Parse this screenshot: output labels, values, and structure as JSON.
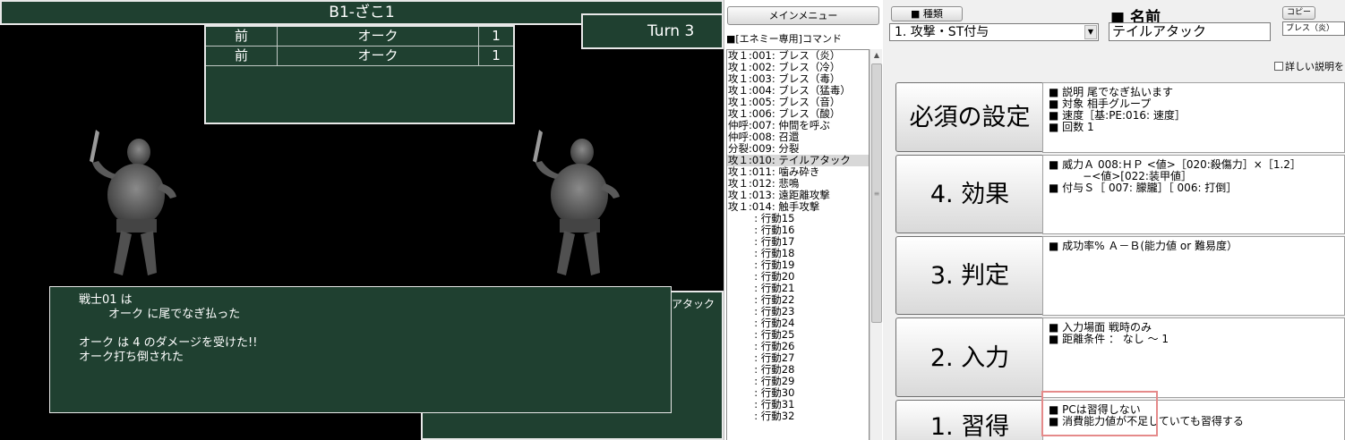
{
  "game": {
    "title": "B1-ざこ1",
    "turn": "Turn 3",
    "enemies": [
      {
        "row": "前",
        "name": "オーク",
        "count": "1"
      },
      {
        "row": "前",
        "name": "オーク",
        "count": "1"
      }
    ],
    "back_panel_label": "ルアタック",
    "messages": [
      "戦士01 は",
      "        オーク に尾でなぎ払った",
      "",
      "オーク は 4 のダメージを受けた!!",
      "オーク打ち倒された"
    ]
  },
  "command_list": {
    "main_menu_label": "メインメニュー",
    "caption": "■[エネミー専用]コマンド",
    "selected_index": 9,
    "items": [
      "攻１:001: ブレス（炎）",
      "攻１:002: ブレス（冷）",
      "攻１:003: ブレス（毒）",
      "攻１:004: ブレス（猛毒）",
      "攻１:005: ブレス（音）",
      "攻１:006: ブレス（酸）",
      "仲呼:007: 仲間を呼ぶ",
      "仲呼:008: 召還",
      "分裂:009: 分裂",
      "攻１:010: テイルアタック",
      "攻１:011: 噛み砕き",
      "攻１:012: 悲鳴",
      "攻１:013: 遠距離攻撃",
      "攻１:014: 触手攻撃",
      "        : 行動15",
      "        : 行動16",
      "        : 行動17",
      "        : 行動18",
      "        : 行動19",
      "        : 行動20",
      "        : 行動21",
      "        : 行動22",
      "        : 行動23",
      "        : 行動24",
      "        : 行動25",
      "        : 行動26",
      "        : 行動27",
      "        : 行動28",
      "        : 行動29",
      "        : 行動30",
      "        : 行動31",
      "        : 行動32"
    ]
  },
  "editor": {
    "kind_button": "■ 種類",
    "kind_value": "1. 攻撃・ST付与",
    "name_label": "■ 名前",
    "name_value": "テイルアタック",
    "copy_button": "コピー",
    "copy_value": "ブレス（炎）",
    "detail_checkbox_label": "詳しい説明を",
    "sections": [
      {
        "button": "必須の設定",
        "lines": [
          "■ 説明 尾でなぎ払います",
          "■ 対象 相手グループ",
          "■ 速度［基:PE:016: 速度］",
          "■ 回数 1"
        ]
      },
      {
        "button": "4. 効果",
        "lines": [
          "■ 威力Ａ 008:ＨＰ <値>［020:殺傷力］×［1.2］",
          "          −<値>[022:装甲値］",
          "■ 付与Ｓ［ 007: 朦朧］［ 006: 打倒］"
        ]
      },
      {
        "button": "3. 判定",
        "lines": [
          "■ 成功率% Ａ－Ｂ(能力値 or 難易度）"
        ]
      },
      {
        "button": "2. 入力",
        "lines": [
          "■ 入力場面 戦時のみ",
          "■ 距離条件 ： なし ～ 1"
        ]
      },
      {
        "button": "1. 習得",
        "lines": [
          "■ PCは習得しない",
          "■ 消費能力値が不足していても習得する"
        ]
      }
    ]
  },
  "colors": {
    "game_panel": "#1f4030",
    "highlight_box": "#e58a8a"
  }
}
